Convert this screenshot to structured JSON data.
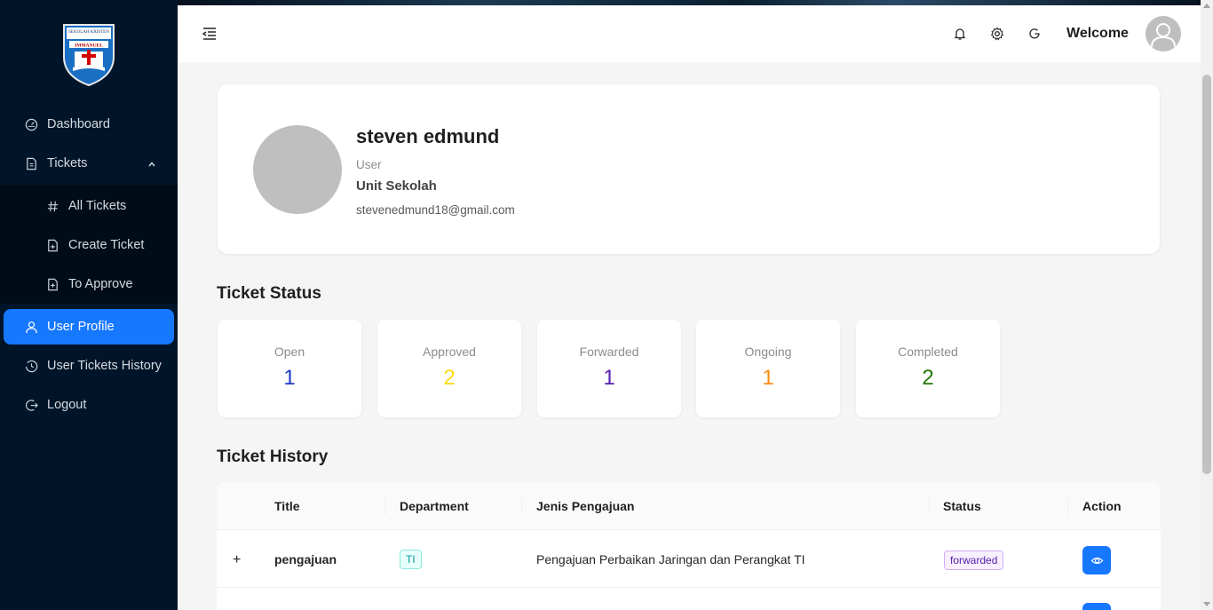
{
  "sidebar": {
    "logo_text_top": "SEKOLAH KRISTEN",
    "logo_text_banner": "IMMANUEL",
    "items": [
      {
        "label": "Dashboard",
        "icon": "dashboard-icon"
      },
      {
        "label": "Tickets",
        "icon": "file-icon"
      },
      {
        "label": "All Tickets",
        "icon": "hash-icon"
      },
      {
        "label": "Create Ticket",
        "icon": "file-add-icon"
      },
      {
        "label": "To Approve",
        "icon": "file-check-icon"
      },
      {
        "label": "User Profile",
        "icon": "user-icon"
      },
      {
        "label": "User Tickets History",
        "icon": "history-icon"
      },
      {
        "label": "Logout",
        "icon": "logout-icon"
      }
    ]
  },
  "header": {
    "welcome": "Welcome",
    "icons": [
      "bell-icon",
      "gear-icon",
      "refresh-icon"
    ]
  },
  "profile": {
    "name": "steven edmund",
    "role": "User",
    "unit": "Unit Sekolah",
    "email": "stevenedmund18@gmail.com"
  },
  "ticket_status": {
    "title": "Ticket Status",
    "cards": [
      {
        "label": "Open",
        "value": "1",
        "color": "#1d39c4"
      },
      {
        "label": "Approved",
        "value": "2",
        "color": "#fadb14"
      },
      {
        "label": "Forwarded",
        "value": "1",
        "color": "#531dab"
      },
      {
        "label": "Ongoing",
        "value": "1",
        "color": "#fa8c16"
      },
      {
        "label": "Completed",
        "value": "2",
        "color": "#237804"
      }
    ]
  },
  "ticket_history": {
    "title": "Ticket History",
    "columns": [
      "Title",
      "Department",
      "Jenis Pengajuan",
      "Status",
      "Action"
    ],
    "rows": [
      {
        "expand": "+",
        "title": "pengajuan",
        "department": "TI",
        "jenis": "Pengajuan Perbaikan Jaringan dan Perangkat TI",
        "status": "forwarded"
      }
    ]
  },
  "colors": {
    "sidebar_bg": "#001529",
    "accent": "#1677ff",
    "content_bg": "#f5f5f5"
  }
}
